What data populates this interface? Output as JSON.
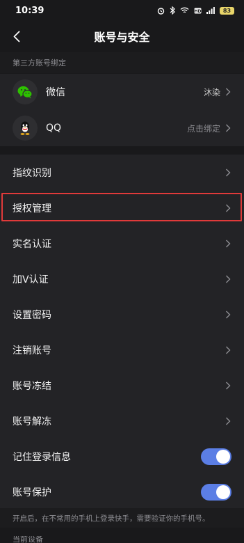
{
  "status_bar": {
    "time": "10:39",
    "battery": "83",
    "icons": [
      "alarm-icon",
      "bluetooth-icon",
      "wifi-icon",
      "hd-icon",
      "signal-icon",
      "battery-icon"
    ]
  },
  "nav": {
    "title": "账号与安全",
    "back_icon": "chevron-left-icon"
  },
  "third_party": {
    "header": "第三方账号绑定",
    "items": [
      {
        "label": "微信",
        "value": "沐染",
        "icon": "wechat-icon"
      },
      {
        "label": "QQ",
        "value": "点击绑定",
        "icon": "qq-icon"
      }
    ]
  },
  "settings": {
    "items": [
      {
        "label": "指纹识别"
      },
      {
        "label": "授权管理",
        "highlighted": true
      },
      {
        "label": "实名认证"
      },
      {
        "label": "加V认证"
      },
      {
        "label": "设置密码"
      },
      {
        "label": "注销账号"
      },
      {
        "label": "账号冻结"
      },
      {
        "label": "账号解冻"
      }
    ],
    "toggles": [
      {
        "label": "记住登录信息",
        "on": true
      },
      {
        "label": "账号保护",
        "on": true
      }
    ]
  },
  "footnote": "开启后，在不常用的手机上登录快手，需要验证你的手机号。",
  "bottom_partial": "当前设备",
  "colors": {
    "background": "#19191b",
    "row": "#232326",
    "toggle_on": "#5b7ee5",
    "highlight_border": "#e03a3a",
    "wechat_green": "#2dc100"
  }
}
